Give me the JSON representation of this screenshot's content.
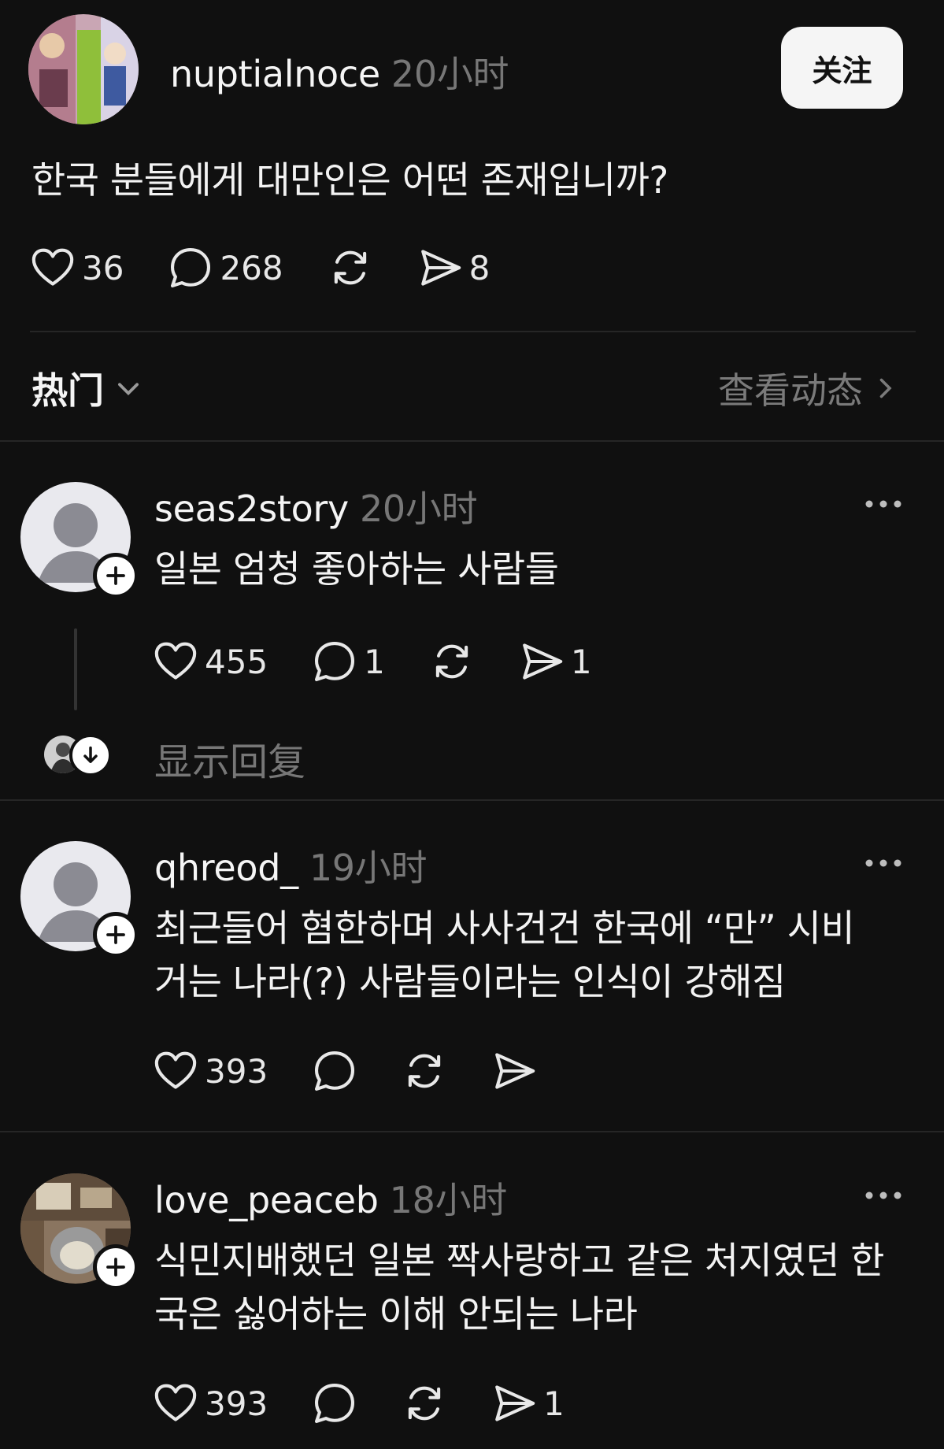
{
  "post": {
    "username": "nuptialnoce",
    "time": "20小时",
    "follow_label": "关注",
    "text": "한국 분들에게 대만인은 어떤 존재입니까?",
    "likes": "36",
    "comments": "268",
    "shares": "8"
  },
  "sort_bar": {
    "sort_label": "热门",
    "activity_label": "查看动态"
  },
  "replies": [
    {
      "username": "seas2story",
      "time": "20小时",
      "lines": [
        "일본 엄청 좋아하는 사람들"
      ],
      "likes": "455",
      "comments": "1",
      "shares": "1",
      "show_replies_label": "显示回复"
    },
    {
      "username": "qhreod_",
      "time": "19小时",
      "lines": [
        "최근들어 혐한하며 사사건건 한국에 “만” 시비",
        "거는 나라(?) 사람들이라는 인식이 강해짐"
      ],
      "likes": "393",
      "comments": "",
      "shares": ""
    },
    {
      "username": "love_peaceb",
      "time": "18小时",
      "lines": [
        "식민지배했던 일본 짝사랑하고 같은 처지였던 한",
        "국은 싫어하는 이해 안되는 나라"
      ],
      "likes": "393",
      "comments": "",
      "shares": "1"
    }
  ],
  "colors": {
    "background": "#101010",
    "text": "#f3f3f3",
    "muted": "#777777",
    "divider": "#262626"
  }
}
